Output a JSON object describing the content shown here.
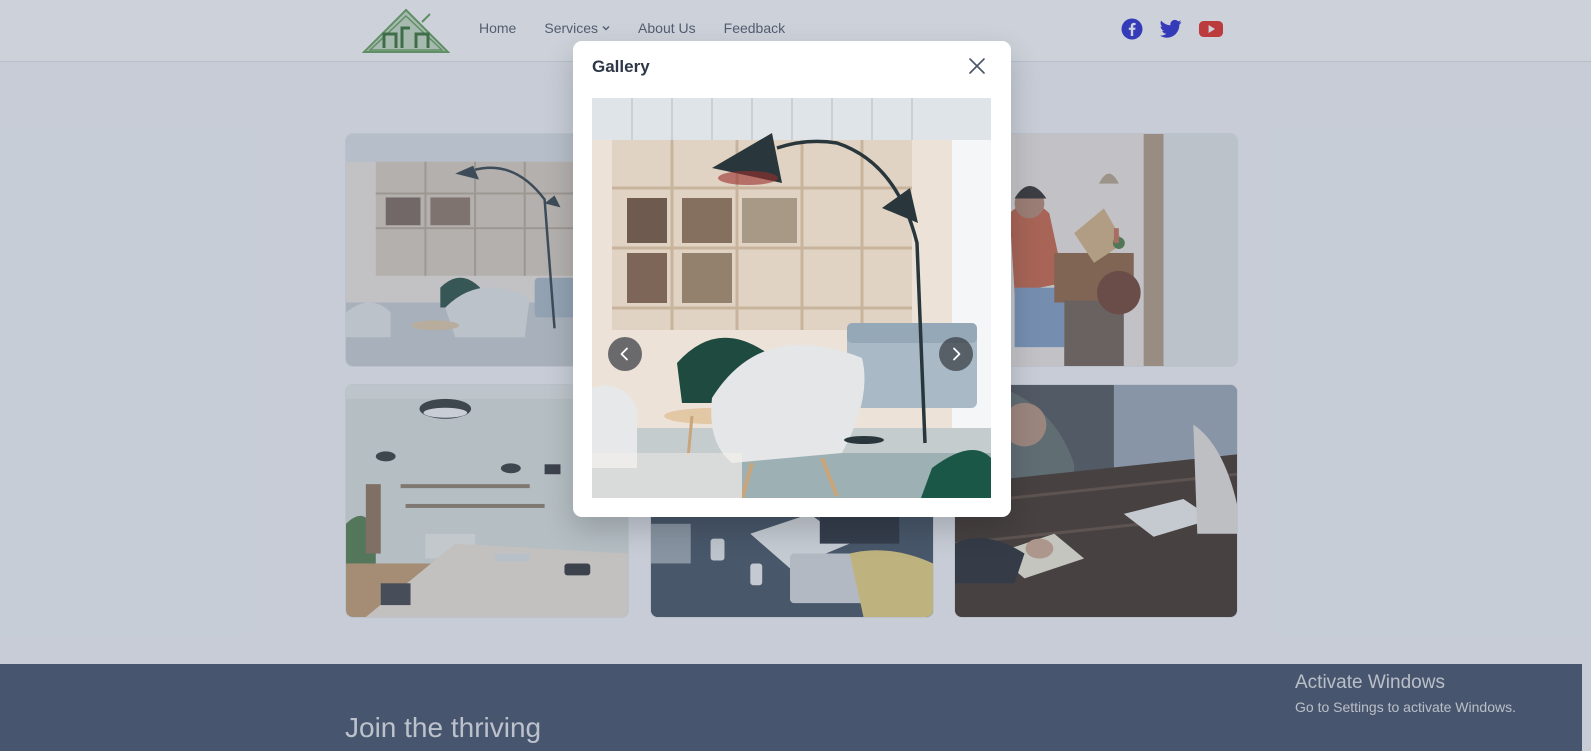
{
  "nav": {
    "items": [
      {
        "label": "Home"
      },
      {
        "label": "Services"
      },
      {
        "label": "About Us"
      },
      {
        "label": "Feedback"
      }
    ],
    "social": [
      "facebook-icon",
      "twitter-icon",
      "youtube-icon"
    ]
  },
  "gallery": {
    "tiles": [
      {
        "subject": "office lounge with lamps and chairs"
      },
      {
        "subject": "office lounge hidden behind modal"
      },
      {
        "subject": "woman sketching at a desk"
      },
      {
        "subject": "coworking room with long table"
      },
      {
        "subject": "team meeting with laptops"
      },
      {
        "subject": "people writing at wooden table"
      }
    ]
  },
  "modal": {
    "title": "Gallery",
    "close_icon": "close-icon",
    "prev_icon": "chevron-left-icon",
    "next_icon": "chevron-right-icon"
  },
  "footer": {
    "heading": "Join the thriving"
  },
  "watermark": {
    "title": "Activate Windows",
    "subtitle": "Go to Settings to activate Windows."
  },
  "colors": {
    "footer_bg": "#3b4861",
    "facebook": "#1f1fcf",
    "twitter": "#1f1fcf",
    "youtube": "#e62117",
    "logo_green": "#5f9c53"
  }
}
